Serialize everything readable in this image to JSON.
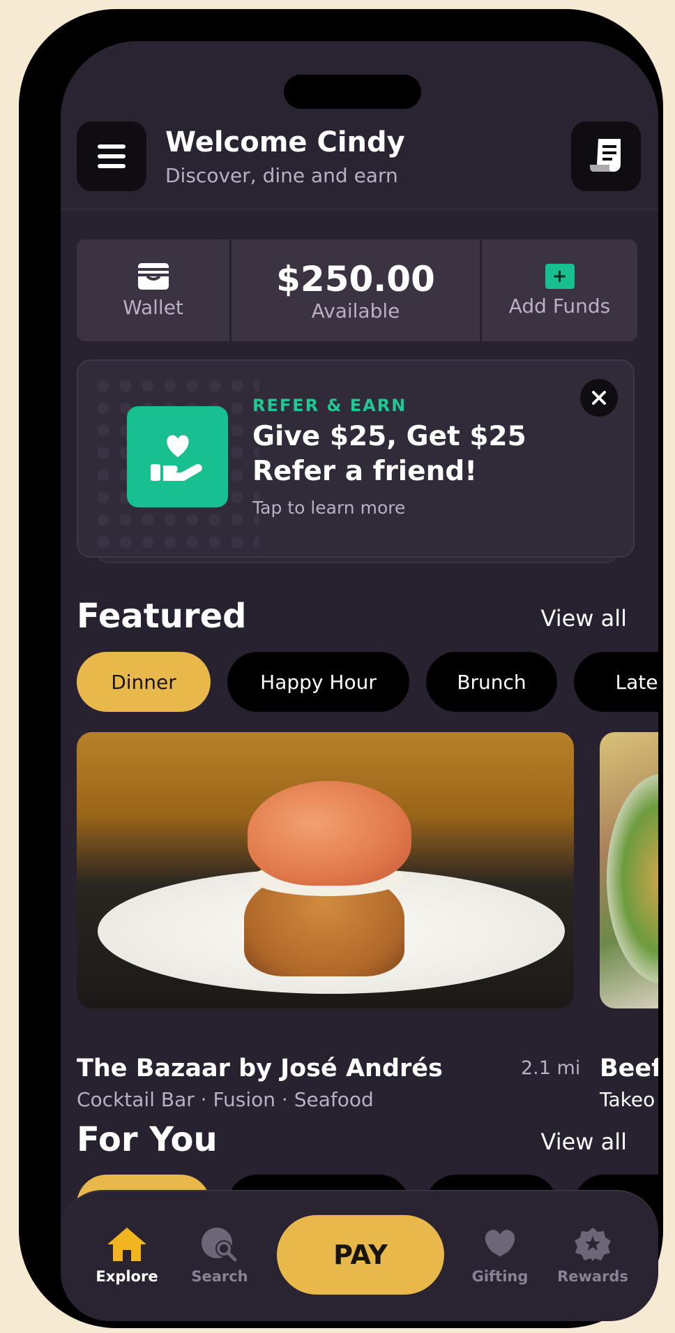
{
  "header": {
    "title": "Welcome Cindy",
    "subtitle": "Discover, dine and earn",
    "menu_icon": "hamburger-menu-icon",
    "receipt_icon": "receipt-icon"
  },
  "wallet": {
    "label": "Wallet",
    "balance": "$250.00",
    "balance_label": "Available",
    "add_funds_label": "Add Funds",
    "add_funds_icon": "+"
  },
  "refer": {
    "kicker": "REFER & EARN",
    "headline": "Give $25, Get $25 Refer a friend!",
    "hint": "Tap to learn more"
  },
  "featured": {
    "title": "Featured",
    "view_all": "View all",
    "chips": [
      "Dinner",
      "Happy Hour",
      "Brunch",
      "Late"
    ],
    "cards": [
      {
        "name": "The Bazaar by José Andrés",
        "distance": "2.1 mi",
        "tags": "Cocktail Bar · Fusion ·  Seafood"
      },
      {
        "name": "Beefs",
        "tags": "Takeo"
      }
    ]
  },
  "for_you": {
    "title": "For You",
    "view_all": "View all"
  },
  "tabbar": {
    "explore": "Explore",
    "search": "Search",
    "pay": "PAY",
    "gifting": "Gifting",
    "rewards": "Rewards"
  },
  "colors": {
    "background": "#28212f",
    "accent_yellow": "#e8b84a",
    "accent_green": "#18c08f"
  }
}
